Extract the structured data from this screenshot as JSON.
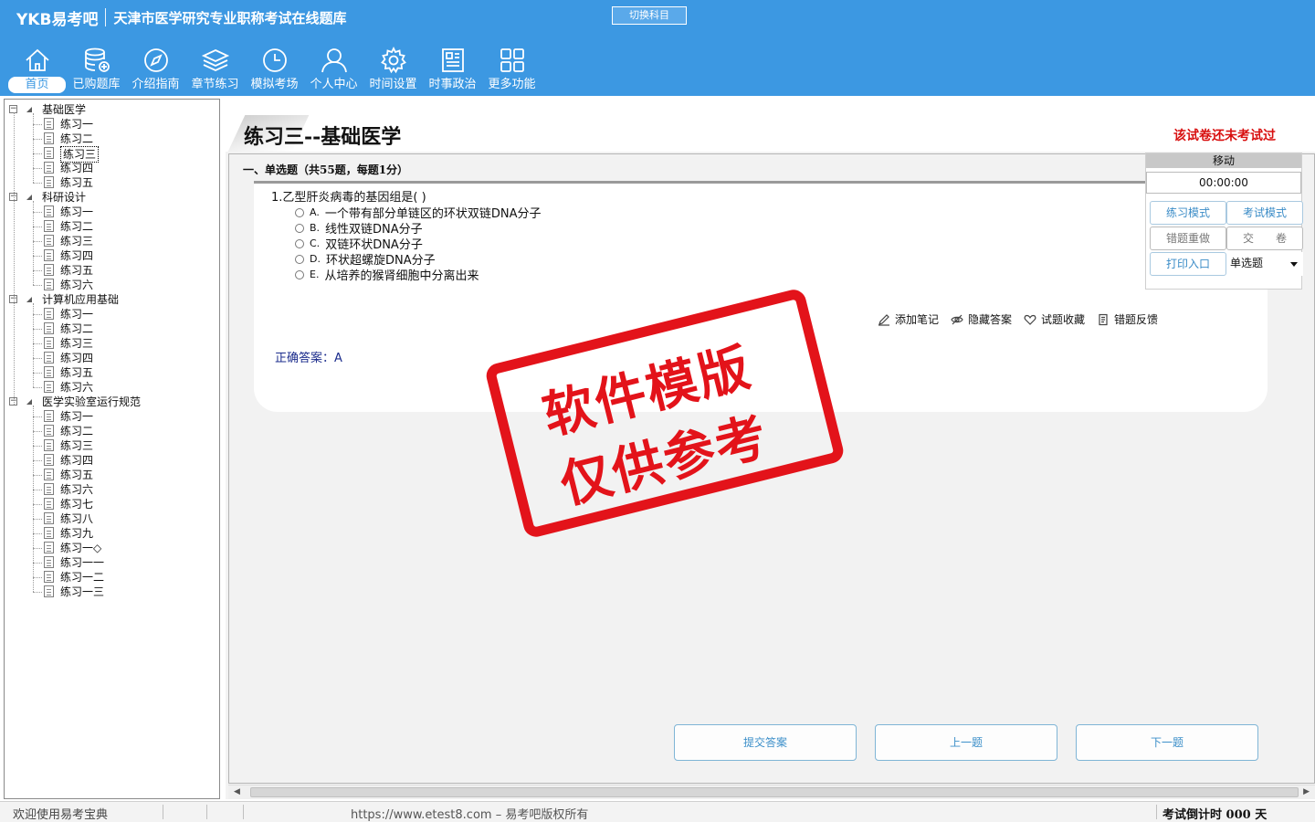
{
  "header": {
    "logo": "YKB易考吧",
    "app_title": "天津市医学研究专业职称考试在线题库",
    "switch_subject": "切换科目"
  },
  "nav": [
    {
      "label": "首页",
      "icon": "home-icon"
    },
    {
      "label": "已购题库",
      "icon": "database-icon"
    },
    {
      "label": "介绍指南",
      "icon": "compass-icon"
    },
    {
      "label": "章节练习",
      "icon": "layers-icon"
    },
    {
      "label": "模拟考场",
      "icon": "clock-icon"
    },
    {
      "label": "个人中心",
      "icon": "user-icon"
    },
    {
      "label": "时间设置",
      "icon": "gear-icon"
    },
    {
      "label": "时事政治",
      "icon": "news-icon"
    },
    {
      "label": "更多功能",
      "icon": "grid-icon"
    }
  ],
  "tree": [
    {
      "label": "基础医学",
      "items": [
        "练习一",
        "练习二",
        "练习三",
        "练习四",
        "练习五"
      ]
    },
    {
      "label": "科研设计",
      "items": [
        "练习一",
        "练习二",
        "练习三",
        "练习四",
        "练习五",
        "练习六"
      ]
    },
    {
      "label": "计算机应用基础",
      "items": [
        "练习一",
        "练习二",
        "练习三",
        "练习四",
        "练习五",
        "练习六"
      ]
    },
    {
      "label": "医学实验室运行规范",
      "items": [
        "练习一",
        "练习二",
        "练习三",
        "练习四",
        "练习五",
        "练习六",
        "练习七",
        "练习八",
        "练习九",
        "练习一◇",
        "练习一一",
        "练习一二",
        "练习一三"
      ]
    }
  ],
  "exam": {
    "title": "练习三--基础医学",
    "status": "该试卷还未考试过",
    "section": "一、单选题（共55题，每题1分）"
  },
  "question": {
    "text": "1.乙型肝炎病毒的基因组是( )",
    "options": [
      {
        "key": "A.",
        "text": "一个带有部分单链区的环状双链DNA分子"
      },
      {
        "key": "B.",
        "text": "线性双链DNA分子"
      },
      {
        "key": "C.",
        "text": "双链环状DNA分子"
      },
      {
        "key": "D.",
        "text": "环状超螺旋DNA分子"
      },
      {
        "key": "E.",
        "text": "从培养的猴肾细胞中分离出来"
      }
    ],
    "answer": "正确答案：A"
  },
  "tools": [
    "添加笔记",
    "隐藏答案",
    "试题收藏",
    "错题反馈"
  ],
  "buttons": {
    "submit": "提交答案",
    "prev": "上一题",
    "next": "下一题"
  },
  "panel": {
    "move": "移动",
    "timer": "00:00:00",
    "practice_mode": "练习模式",
    "exam_mode": "考试模式",
    "redo_wrong": "错题重做",
    "hand_in": "交　　卷",
    "print": "打印入口",
    "type_selected": "单选题"
  },
  "stamp": {
    "line1": "软件模版",
    "line2": "仅供参考"
  },
  "status": {
    "welcome": "欢迎使用易考宝典",
    "copyright": "https://www.etest8.com – 易考吧版权所有",
    "countdown": "考试倒计时 000 天"
  },
  "colors": {
    "brand_blue": "#3c98e2",
    "alert_red": "#d80f0f",
    "stamp_red": "#e3131a"
  }
}
